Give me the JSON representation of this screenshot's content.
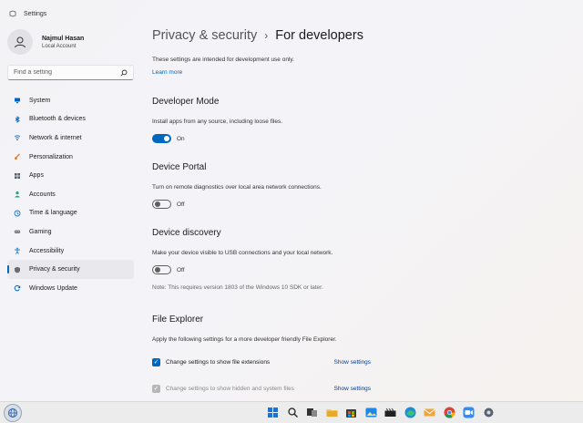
{
  "window": {
    "title": "Settings"
  },
  "profile": {
    "name": "Najmul Hasan",
    "account_type": "Local Account"
  },
  "search": {
    "placeholder": "Find a setting"
  },
  "nav": [
    {
      "label": "System",
      "icon": "system-icon",
      "color": "#0067c0",
      "active": false
    },
    {
      "label": "Bluetooth & devices",
      "icon": "bluetooth-icon",
      "color": "#0067c0",
      "active": false
    },
    {
      "label": "Network & internet",
      "icon": "network-icon",
      "color": "#1d78c9",
      "active": false
    },
    {
      "label": "Personalization",
      "icon": "brush-icon",
      "color": "#e07b2e",
      "active": false
    },
    {
      "label": "Apps",
      "icon": "apps-icon",
      "color": "#55606b",
      "active": false
    },
    {
      "label": "Accounts",
      "icon": "accounts-icon",
      "color": "#2aa07d",
      "active": false
    },
    {
      "label": "Time & language",
      "icon": "globe-clock-icon",
      "color": "#1d78c9",
      "active": false
    },
    {
      "label": "Gaming",
      "icon": "gaming-icon",
      "color": "#7a7a7a",
      "active": false
    },
    {
      "label": "Accessibility",
      "icon": "accessibility-icon",
      "color": "#1d78c9",
      "active": false
    },
    {
      "label": "Privacy & security",
      "icon": "shield-icon",
      "color": "#6b6b75",
      "active": true
    },
    {
      "label": "Windows Update",
      "icon": "update-icon",
      "color": "#0067c0",
      "active": false
    }
  ],
  "breadcrumb": {
    "parent": "Privacy & security",
    "separator": "›",
    "current": "For developers"
  },
  "intro": {
    "text": "These settings are intended for development use only.",
    "link": "Learn more"
  },
  "sections": {
    "developer_mode": {
      "title": "Developer Mode",
      "description": "Install apps from any source, including loose files.",
      "state": "On"
    },
    "device_portal": {
      "title": "Device Portal",
      "description": "Turn on remote diagnostics over local area network connections.",
      "state": "Off"
    },
    "device_discovery": {
      "title": "Device discovery",
      "description": "Make your device visible to USB connections and your local network.",
      "state": "Off",
      "note": "Note: This requires version 1803 of the Windows 10 SDK or later."
    },
    "file_explorer": {
      "title": "File Explorer",
      "description": "Apply the following settings for a more developer friendly File Explorer.",
      "options": [
        {
          "label": "Change settings to show file extensions",
          "checked": true,
          "disabled": false,
          "action": "Show settings"
        },
        {
          "label": "Change settings to show hidden and system files",
          "checked": true,
          "disabled": true,
          "action": "Show settings"
        }
      ]
    }
  },
  "accent_color": "#0067c0",
  "taskbar": {
    "icons": [
      "windows-start-icon",
      "search-icon",
      "task-view-icon",
      "file-explorer-icon",
      "store-icon",
      "photos-icon",
      "media-icon",
      "edge-icon",
      "mail-icon",
      "chrome-icon",
      "zoom-icon",
      "settings-icon"
    ]
  }
}
